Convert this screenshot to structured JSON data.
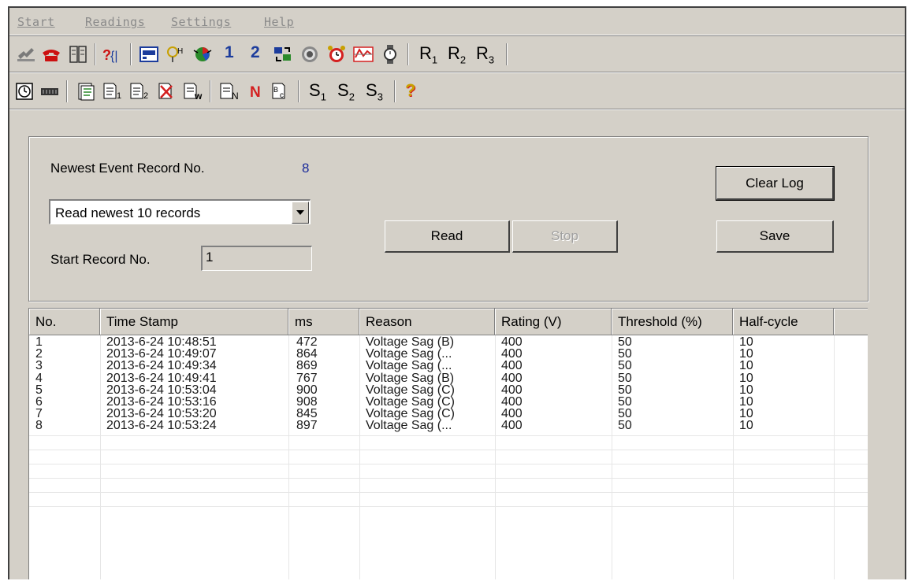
{
  "menu": {
    "items": [
      {
        "label": "Start"
      },
      {
        "label": "Readings"
      },
      {
        "label": "Settings"
      },
      {
        "label": "Help"
      }
    ]
  },
  "toolbar1": {
    "num_labels": [
      "1",
      "2"
    ],
    "r_labels": [
      {
        "main": "R",
        "sub": "1"
      },
      {
        "main": "R",
        "sub": "2"
      },
      {
        "main": "R",
        "sub": "3"
      }
    ]
  },
  "toolbar2": {
    "s_labels": [
      {
        "main": "S",
        "sub": "1"
      },
      {
        "main": "S",
        "sub": "2"
      },
      {
        "main": "S",
        "sub": "3"
      }
    ],
    "help_glyph": "?"
  },
  "panel": {
    "newest_label": "Newest Event Record No.",
    "newest_value": "8",
    "mode_select": "Read newest 10 records",
    "start_label": "Start Record No.",
    "start_value": "1",
    "read_label": "Read",
    "stop_label": "Stop",
    "clear_label": "Clear Log",
    "save_label": "Save"
  },
  "table": {
    "columns": [
      "No.",
      "Time Stamp",
      "ms",
      "Reason",
      "Rating (V)",
      "Threshold (%)",
      "Half-cycle"
    ],
    "rows": [
      [
        "1",
        "2013-6-24 10:48:51",
        "472",
        "Voltage Sag (B)",
        "400",
        "50",
        "10"
      ],
      [
        "2",
        "2013-6-24 10:49:07",
        "864",
        "Voltage Sag (...",
        "400",
        "50",
        "10"
      ],
      [
        "3",
        "2013-6-24 10:49:34",
        "869",
        "Voltage Sag (...",
        "400",
        "50",
        "10"
      ],
      [
        "4",
        "2013-6-24 10:49:41",
        "767",
        "Voltage Sag (B)",
        "400",
        "50",
        "10"
      ],
      [
        "5",
        "2013-6-24 10:53:04",
        "900",
        "Voltage Sag (C)",
        "400",
        "50",
        "10"
      ],
      [
        "6",
        "2013-6-24 10:53:16",
        "908",
        "Voltage Sag (C)",
        "400",
        "50",
        "10"
      ],
      [
        "7",
        "2013-6-24 10:53:20",
        "845",
        "Voltage Sag (C)",
        "400",
        "50",
        "10"
      ],
      [
        "8",
        "2013-6-24 10:53:24",
        "897",
        "Voltage Sag (...",
        "400",
        "50",
        "10"
      ]
    ]
  }
}
